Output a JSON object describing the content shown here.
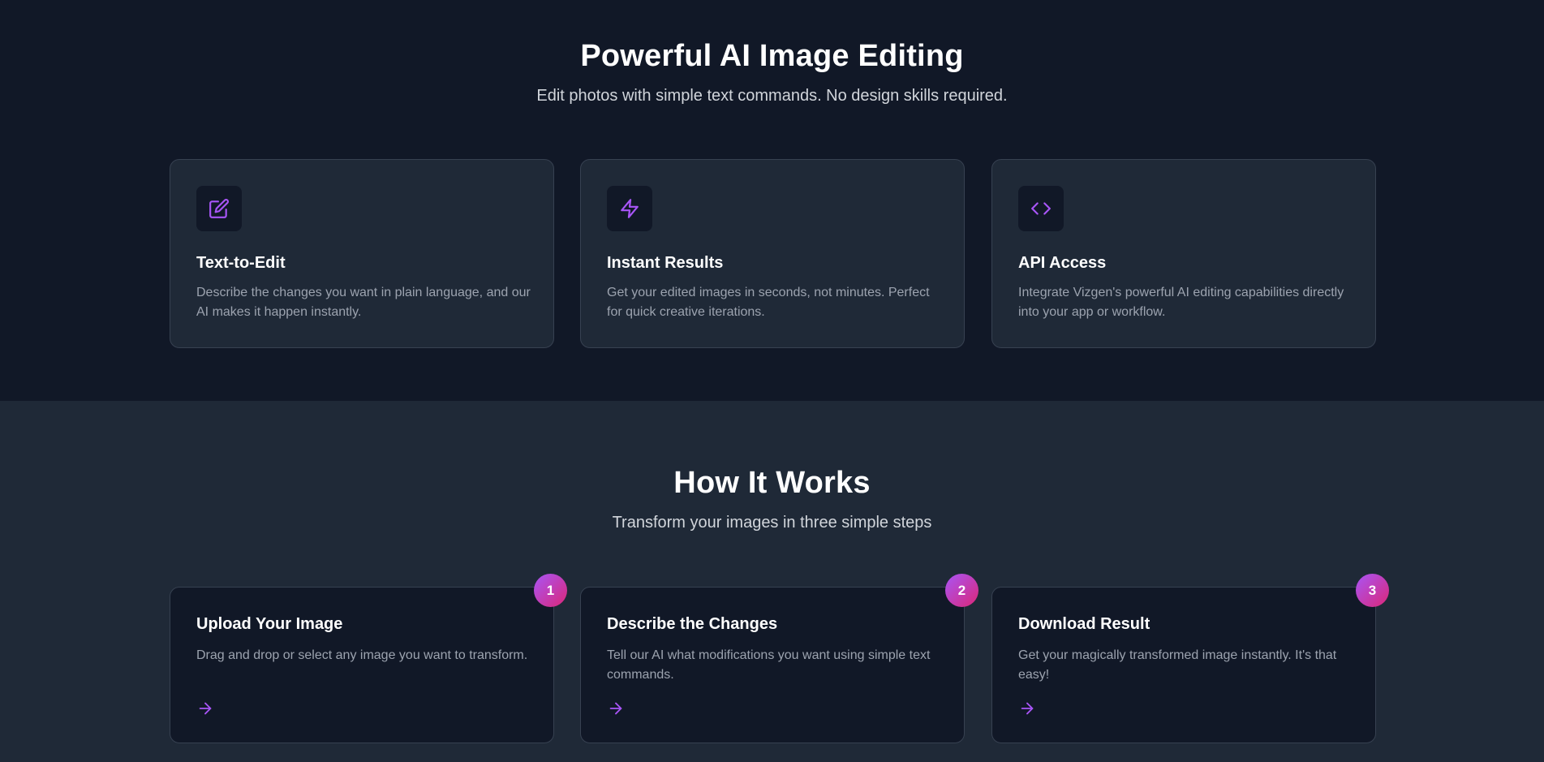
{
  "features": {
    "title": "Powerful AI Image Editing",
    "subtitle": "Edit photos with simple text commands. No design skills required.",
    "cards": [
      {
        "icon": "edit-icon",
        "title": "Text-to-Edit",
        "desc": "Describe the changes you want in plain language, and our AI makes it happen instantly."
      },
      {
        "icon": "lightning-icon",
        "title": "Instant Results",
        "desc": "Get your edited images in seconds, not minutes. Perfect for quick creative iterations."
      },
      {
        "icon": "code-icon",
        "title": "API Access",
        "desc": "Integrate Vizgen's powerful AI editing capabilities directly into your app or workflow."
      }
    ]
  },
  "how": {
    "title": "How It Works",
    "subtitle": "Transform your images in three simple steps",
    "steps": [
      {
        "number": "1",
        "title": "Upload Your Image",
        "desc": "Drag and drop or select any image you want to transform."
      },
      {
        "number": "2",
        "title": "Describe the Changes",
        "desc": "Tell our AI what modifications you want using simple text commands."
      },
      {
        "number": "3",
        "title": "Download Result",
        "desc": "Get your magically transformed image instantly. It's that easy!"
      }
    ]
  },
  "colors": {
    "accent": "#a855f7",
    "accent_pink": "#db2777",
    "bg_dark": "#111827",
    "bg_card": "#1f2937"
  }
}
